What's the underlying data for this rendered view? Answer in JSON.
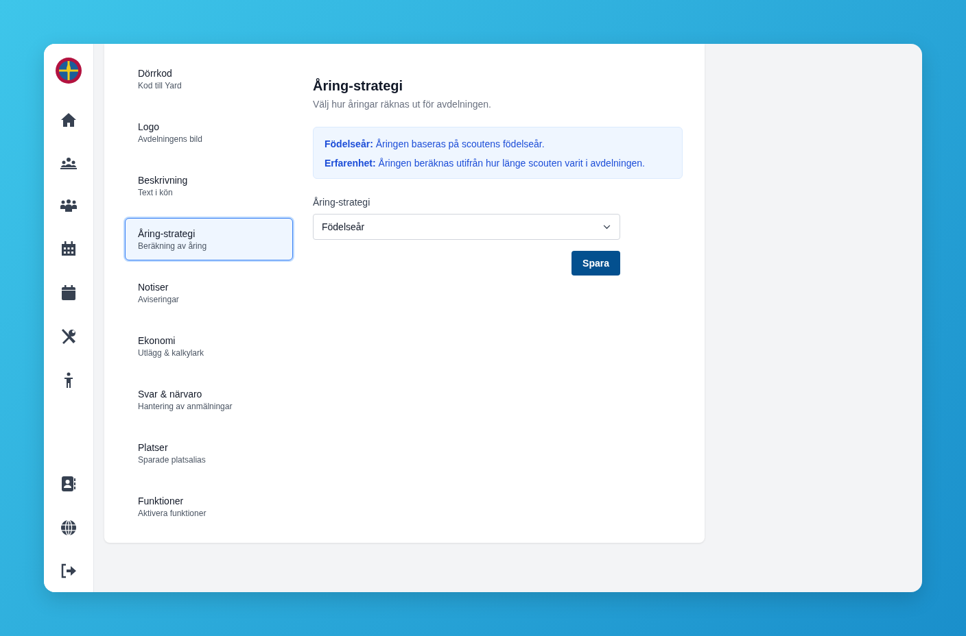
{
  "settings_menu": [
    {
      "title": "Dörrkod",
      "subtitle": "Kod till Yard",
      "selected": false
    },
    {
      "title": "Logo",
      "subtitle": "Avdelningens bild",
      "selected": false
    },
    {
      "title": "Beskrivning",
      "subtitle": "Text i kön",
      "selected": false
    },
    {
      "title": "Åring-strategi",
      "subtitle": "Beräkning av åring",
      "selected": true
    },
    {
      "title": "Notiser",
      "subtitle": "Aviseringar",
      "selected": false
    },
    {
      "title": "Ekonomi",
      "subtitle": "Utlägg & kalkylark",
      "selected": false
    },
    {
      "title": "Svar & närvaro",
      "subtitle": "Hantering av anmälningar",
      "selected": false
    },
    {
      "title": "Platser",
      "subtitle": "Sparade platsalias",
      "selected": false
    },
    {
      "title": "Funktioner",
      "subtitle": "Aktivera funktioner",
      "selected": false
    }
  ],
  "panel": {
    "title": "Åring-strategi",
    "description": "Välj hur åringar räknas ut för avdelningen.",
    "info_lines": [
      "**Födelseår:** Åringen baseras på scoutens födelseår.",
      "**Erfarenhet:** Åringen beräknas utifrån hur länge scouten varit i avdelningen."
    ],
    "field_label": "Åring-strategi",
    "select_value": "Födelseår",
    "save_button": "Spara"
  }
}
